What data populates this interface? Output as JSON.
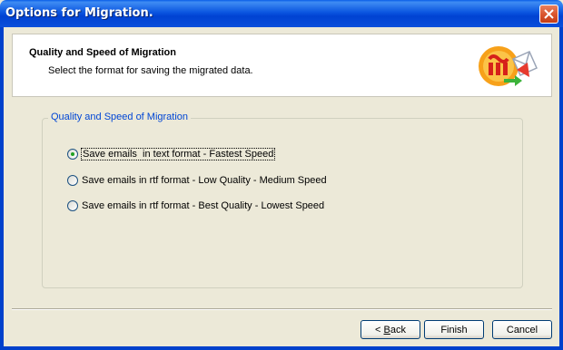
{
  "window": {
    "title": "Options for Migration."
  },
  "header": {
    "title": "Quality and Speed of Migration",
    "subtitle": "Select the format for saving the migrated data."
  },
  "group": {
    "legend": "Quality and Speed of Migration",
    "options": [
      {
        "label": "Save emails  in text format - Fastest Speed",
        "checked": true
      },
      {
        "label": "Save emails in rtf format - Low Quality - Medium Speed",
        "checked": false
      },
      {
        "label": "Save emails in rtf format - Best Quality - Lowest Speed",
        "checked": false
      }
    ]
  },
  "buttons": {
    "back_prefix": "< ",
    "back_accel": "B",
    "back_rest": "ack",
    "finish": "Finish",
    "cancel": "Cancel"
  },
  "colors": {
    "titlebar": "#0a4fdb",
    "legend_text": "#0046d5",
    "radio_dot": "#21a121"
  }
}
